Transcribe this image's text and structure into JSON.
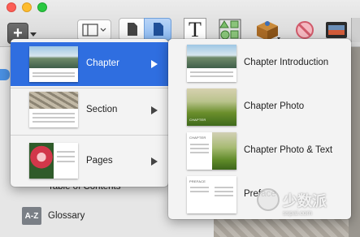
{
  "toolbar": {
    "add_glyph": "+",
    "text_tool_glyph": "T"
  },
  "sidebar": {
    "items": [
      {
        "label": "Table of Contents"
      },
      {
        "label": "Glossary",
        "icon_text": "A-Z"
      }
    ]
  },
  "insert_menu": {
    "items": [
      {
        "label": "Chapter",
        "selected": true,
        "has_submenu": true
      },
      {
        "label": "Section",
        "selected": false,
        "has_submenu": true
      },
      {
        "label": "Pages",
        "selected": false,
        "has_submenu": true
      }
    ]
  },
  "chapter_submenu": {
    "items": [
      {
        "label": "Chapter Introduction"
      },
      {
        "label": "Chapter Photo",
        "thumb_caption": "CHAPTER"
      },
      {
        "label": "Chapter Photo & Text",
        "thumb_caption": "CHAPTER"
      },
      {
        "label": "Preface",
        "thumb_caption": "PREFACE"
      }
    ]
  },
  "watermark": {
    "text": "少数派",
    "url": "sspai.com"
  },
  "colors": {
    "selection": "#2f6ee0",
    "toolbar_bg": "#e2e2e2",
    "menu_bg": "#f3f3f3"
  }
}
